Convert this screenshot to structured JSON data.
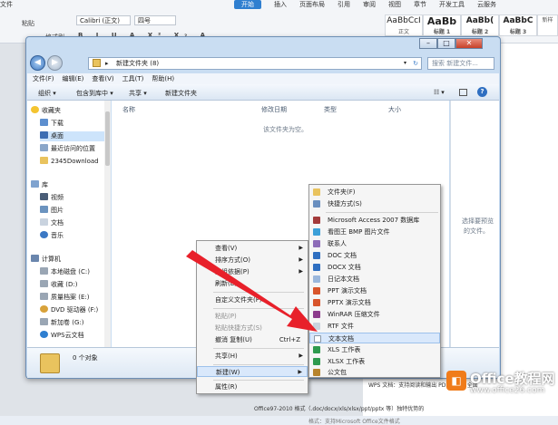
{
  "wps": {
    "menu": [
      "文件",
      "开始",
      "插入",
      "页面布局",
      "引用",
      "审阅",
      "视图",
      "章节",
      "开发工具",
      "云服务"
    ],
    "active_tab": "开始",
    "font_name": "Calibri (正文)",
    "font_size": "四号",
    "paste_label": "粘贴",
    "format_painter": "格式刷",
    "styles": [
      {
        "sample": "AaBbCcI",
        "name": "正文"
      },
      {
        "sample": "AaBb",
        "name": "标题 1"
      },
      {
        "sample": "AaBb(",
        "name": "标题 2"
      },
      {
        "sample": "AaBbC",
        "name": "标题 3"
      },
      {
        "sample": "",
        "name": "新样"
      }
    ]
  },
  "explorer": {
    "path_root": "▸",
    "path": "新建文件夹 (8)",
    "search_placeholder": "搜索 新建文件...",
    "menubar": [
      "文件(F)",
      "编辑(E)",
      "查看(V)",
      "工具(T)",
      "帮助(H)"
    ],
    "toolbar": [
      "组织 ▾",
      "包含到库中 ▾",
      "共享 ▾",
      "新建文件夹"
    ],
    "columns": [
      "名称",
      "修改日期",
      "类型",
      "大小"
    ],
    "empty_text": "该文件夹为空。",
    "preview_text_1": "选择要预览",
    "preview_text_2": "的文件。",
    "status": "0 个对象",
    "nav": {
      "favorites": "收藏夹",
      "fav_items": [
        "下载",
        "桌面",
        "最近访问的位置",
        "2345Download"
      ],
      "library": "库",
      "lib_items": [
        "视频",
        "图片",
        "文档",
        "音乐"
      ],
      "computer": "计算机",
      "comp_items": [
        "本地磁盘 (C:)",
        "收藏 (D:)",
        "质量档案 (E:)",
        "DVD 驱动器 (F:)",
        "新加卷 (G:)",
        "WPS云文档"
      ]
    }
  },
  "context_menu": {
    "items": [
      "查看(V)",
      "排序方式(O)",
      "分组依据(P)",
      "刷新(E)",
      "自定义文件夹(F)...",
      "粘贴(P)",
      "粘贴快捷方式(S)",
      "撤消 复制(U)",
      "共享(H)",
      "新建(W)",
      "属性(R)"
    ],
    "undo_shortcut": "Ctrl+Z"
  },
  "new_submenu": {
    "items": [
      "文件夹(F)",
      "快捷方式(S)",
      "Microsoft Access 2007 数据库",
      "看图王 BMP 图片文件",
      "联系人",
      "DOC 文档",
      "DOCX 文档",
      "日记本文档",
      "PPT 演示文档",
      "PPTX 演示文档",
      "WinRAR 压缩文件",
      "RTF 文件",
      "文本文档",
      "XLS 工作表",
      "XLSX 工作表",
      "公文包"
    ]
  },
  "doc": {
    "line1": "WPS 文档：支持阅读和输出 PDF 文件，全面",
    "line2": "Office97-2010 格式（.doc/docx/xls/xlsx/ppt/pptx 等）独特优势的",
    "line3": "格式：支持Microsoft Office文件格式"
  },
  "watermark": {
    "brand": "Office教程网",
    "url": "www.office26.com"
  },
  "colors": {
    "accent": "#2f7fd0",
    "arrow": "#e8202a",
    "brand_orange": "#f07c1b"
  }
}
